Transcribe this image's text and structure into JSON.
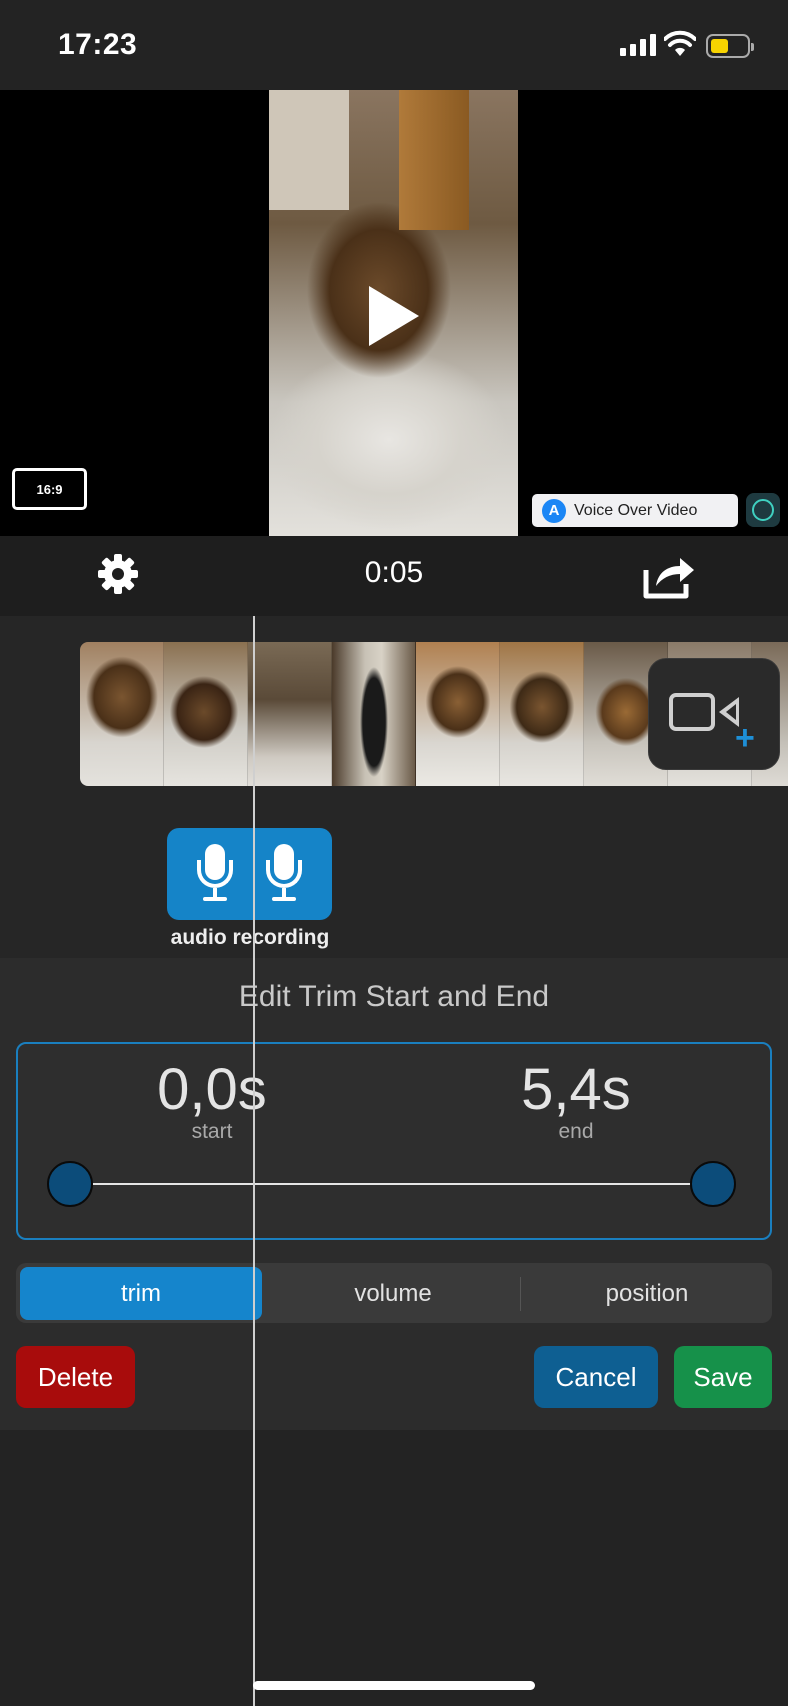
{
  "status_bar": {
    "time": "17:23",
    "icons": [
      "cellular-signal-icon",
      "wifi-icon",
      "battery-icon"
    ],
    "battery_color": "#f7d300"
  },
  "preview": {
    "aspect_ratio_label": "16:9",
    "play_icon": "play-icon",
    "ad": {
      "label": "Voice Over Video",
      "store_icon": "app-store-icon"
    }
  },
  "toolbar": {
    "settings_icon": "gear-icon",
    "playback_time": "0:05",
    "share_icon": "share-icon"
  },
  "timeline": {
    "clip_count": 9,
    "add_video_icon": "add-video-icon",
    "audio_clip": {
      "icon": "microphone-icon",
      "label": "audio recording",
      "color": "#1584c8"
    }
  },
  "edit_panel": {
    "title": "Edit Trim Start and End",
    "start_value": "0,0s",
    "start_label": "start",
    "end_value": "5,4s",
    "end_label": "end",
    "tabs": [
      {
        "label": "trim",
        "selected": true
      },
      {
        "label": "volume",
        "selected": false
      },
      {
        "label": "position",
        "selected": false
      }
    ],
    "delete_label": "Delete",
    "cancel_label": "Cancel",
    "save_label": "Save",
    "colors": {
      "accent": "#1585cc",
      "delete": "#a80c0c",
      "cancel": "#0e5f92",
      "save": "#16914a"
    }
  }
}
